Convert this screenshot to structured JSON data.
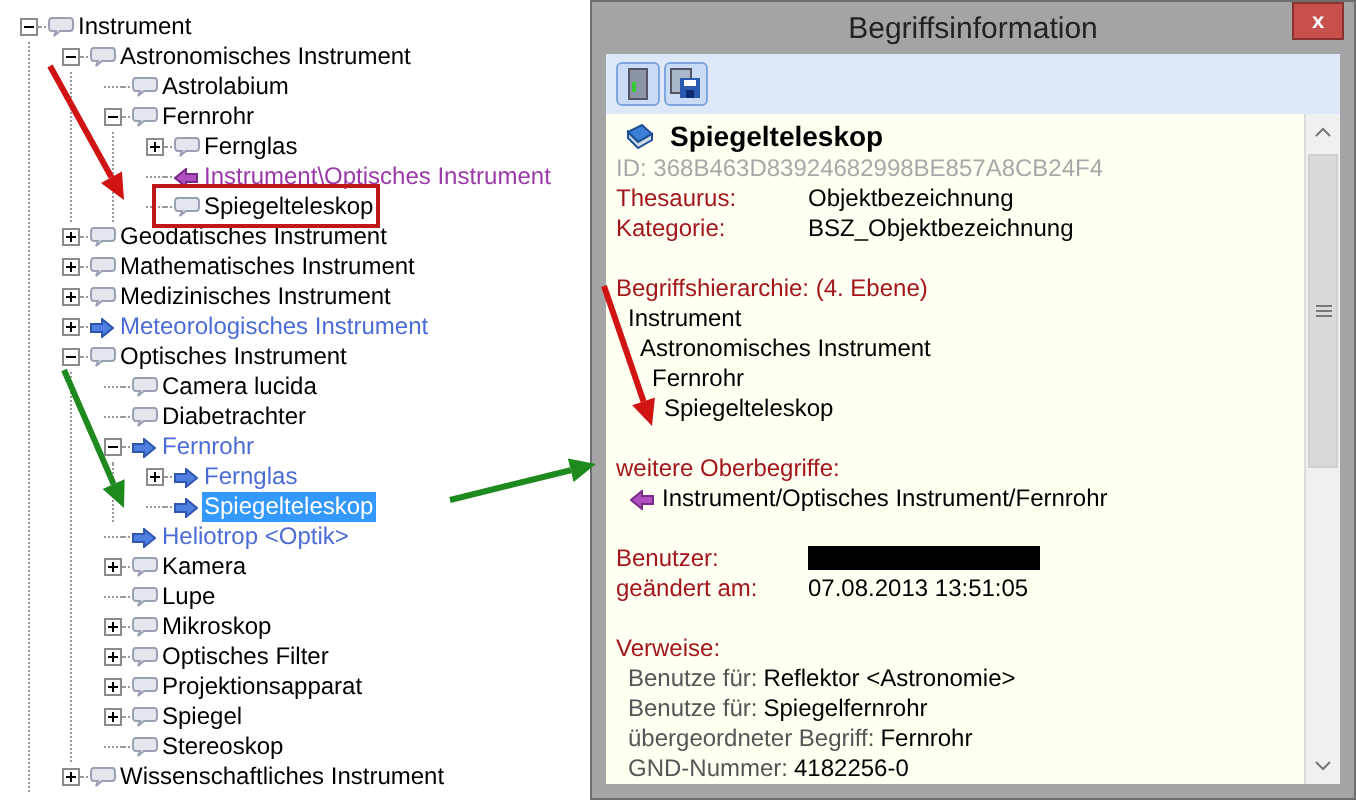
{
  "tree": [
    {
      "label": "Instrument",
      "kind": "term",
      "expanded": true,
      "selected": false,
      "children": [
        {
          "label": "Astronomisches Instrument",
          "kind": "term",
          "expanded": true,
          "selected": false,
          "children": [
            {
              "label": "Astrolabium",
              "kind": "term",
              "selected": false
            },
            {
              "label": "Fernrohr",
              "kind": "term",
              "expanded": true,
              "selected": false,
              "children": [
                {
                  "label": "Fernglas",
                  "kind": "term",
                  "expanded": false,
                  "selected": false
                },
                {
                  "label": "Instrument\\Optisches Instrument",
                  "kind": "link",
                  "selected": false
                },
                {
                  "label": "Spiegelteleskop",
                  "kind": "term",
                  "selected": false
                }
              ]
            }
          ]
        },
        {
          "label": "Geodatisches Instrument",
          "kind": "term",
          "expanded": false,
          "selected": false
        },
        {
          "label": "Mathematisches Instrument",
          "kind": "term",
          "expanded": false,
          "selected": false
        },
        {
          "label": "Medizinisches Instrument",
          "kind": "term",
          "expanded": false,
          "selected": false
        },
        {
          "label": "Meteorologisches Instrument",
          "kind": "reference",
          "expanded": false,
          "selected": false
        },
        {
          "label": "Optisches Instrument",
          "kind": "term",
          "expanded": true,
          "selected": false,
          "children": [
            {
              "label": "Camera lucida",
              "kind": "term",
              "selected": false
            },
            {
              "label": "Diabetrachter",
              "kind": "term",
              "selected": false
            },
            {
              "label": "Fernrohr",
              "kind": "reference",
              "expanded": true,
              "selected": false,
              "children": [
                {
                  "label": "Fernglas",
                  "kind": "reference",
                  "expanded": false,
                  "selected": false
                },
                {
                  "label": "Spiegelteleskop",
                  "kind": "reference",
                  "selected": true
                }
              ]
            },
            {
              "label": "Heliotrop <Optik>",
              "kind": "reference",
              "selected": false
            },
            {
              "label": "Kamera",
              "kind": "term",
              "expanded": false,
              "selected": false
            },
            {
              "label": "Lupe",
              "kind": "term",
              "selected": false
            },
            {
              "label": "Mikroskop",
              "kind": "term",
              "expanded": false,
              "selected": false
            },
            {
              "label": "Optisches Filter",
              "kind": "term",
              "expanded": false,
              "selected": false
            },
            {
              "label": "Projektionsapparat",
              "kind": "term",
              "expanded": false,
              "selected": false
            },
            {
              "label": "Spiegel",
              "kind": "term",
              "expanded": false,
              "selected": false
            },
            {
              "label": "Stereoskop",
              "kind": "term",
              "selected": false
            }
          ]
        },
        {
          "label": "Wissenschaftliches Instrument",
          "kind": "term",
          "expanded": false,
          "selected": false
        }
      ]
    }
  ],
  "dialog": {
    "title": "Begriffsinformation",
    "close": "x",
    "term": "Spiegelteleskop",
    "id": "ID: 368B463D83924682998BE857A8CB24F4",
    "properties": [
      {
        "label": "Thesaurus:",
        "value": "Objektbezeichnung"
      },
      {
        "label": "Kategorie:",
        "value": "BSZ_Objektbezeichnung"
      }
    ],
    "hierarchy_title": "Begriffshierarchie: (4. Ebene)",
    "hierarchy": [
      {
        "label": "Instrument",
        "children": [
          {
            "label": "Astronomisches Instrument",
            "children": [
              {
                "label": "Fernrohr",
                "children": [
                  {
                    "label": "Spiegelteleskop"
                  }
                ]
              }
            ]
          }
        ]
      }
    ],
    "broader_title": "weitere Oberbegriffe:",
    "broader": [
      "Instrument/Optisches Instrument/Fernrohr"
    ],
    "audit": [
      {
        "label": "Benutzer:",
        "kind": "redacted"
      },
      {
        "label": "geändert am:",
        "kind": "text",
        "value": "07.08.2013 13:51:05"
      }
    ],
    "references_title": "Verweise:",
    "references": [
      {
        "label": "Benutze für:",
        "value": "Reflektor <Astronomie>"
      },
      {
        "label": "Benutze für:",
        "value": "Spiegelfernrohr"
      },
      {
        "label": "übergeordneter Begriff:",
        "value": "Fernrohr"
      },
      {
        "label": "GND-Nummer:",
        "value": "4182256-0"
      }
    ]
  }
}
